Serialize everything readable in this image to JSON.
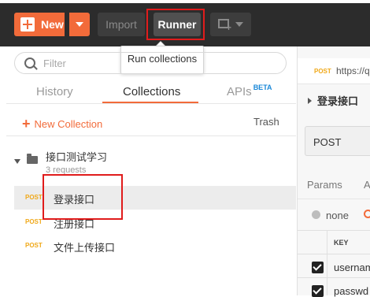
{
  "toolbar": {
    "new_label": "New",
    "import_label": "Import",
    "runner_label": "Runner",
    "runner_tooltip": "Run collections"
  },
  "sidebar": {
    "search_placeholder": "Filter",
    "tabs": {
      "history": "History",
      "collections": "Collections",
      "apis": "APIs",
      "apis_badge": "BETA"
    },
    "new_collection_label": "New Collection",
    "trash_label": "Trash",
    "collection": {
      "name": "接口测试学习",
      "count": "3 requests",
      "requests": [
        {
          "method": "POST",
          "name": "登录接口"
        },
        {
          "method": "POST",
          "name": "注册接口"
        },
        {
          "method": "POST",
          "name": "文件上传接口"
        }
      ]
    }
  },
  "request_panel": {
    "tab_method": "POST",
    "tab_url": "https://q",
    "request_name": "登录接口",
    "method_select": "POST",
    "params_tab": "Params",
    "next_tab_partial": "A",
    "body_option_none": "none",
    "table_key_header": "KEY",
    "rows": [
      {
        "key": "usernam"
      },
      {
        "key": "passwd"
      }
    ]
  },
  "colors": {
    "accent": "#f26b3a",
    "post_method": "#f0a818",
    "toolbar_bg": "#2c2c2c",
    "highlight_box": "#e01c1c"
  }
}
